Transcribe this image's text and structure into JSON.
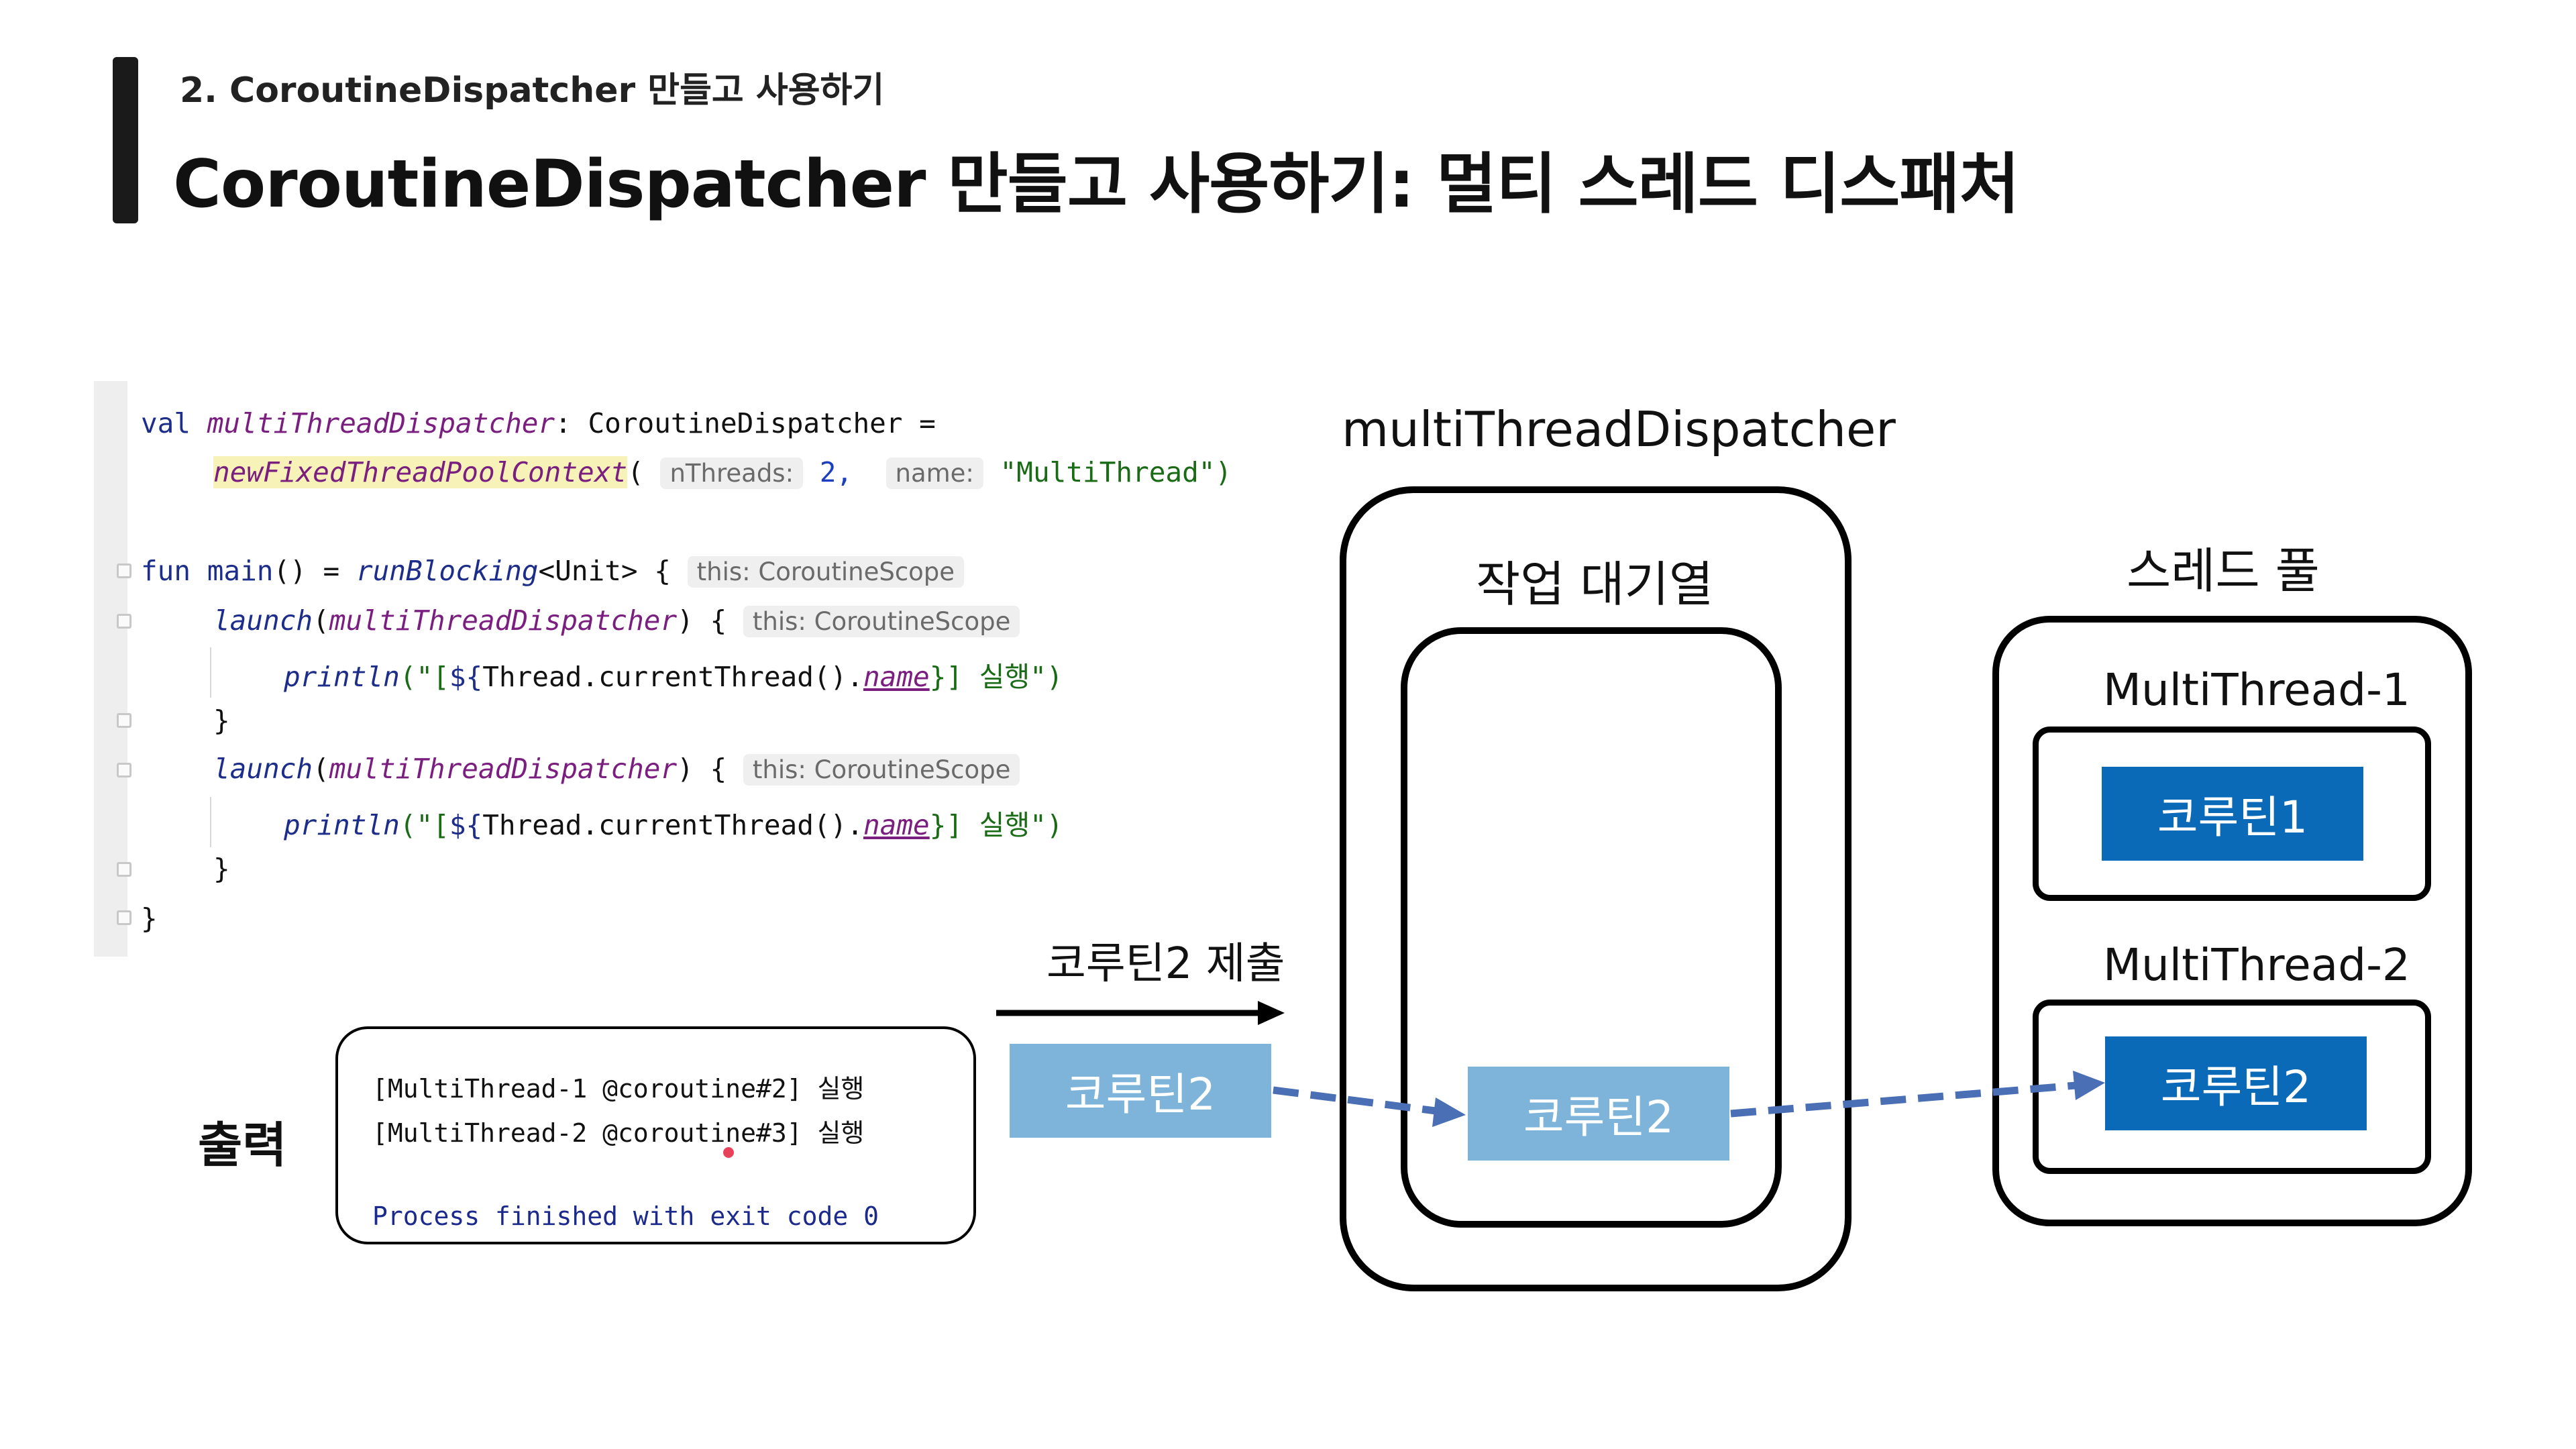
{
  "header": {
    "subtitle": "2. CoroutineDispatcher 만들고 사용하기",
    "title": "CoroutineDispatcher 만들고 사용하기: 멀티 스레드 디스패처"
  },
  "code": {
    "l1_val": "val",
    "l1_name": "multiThreadDispatcher",
    "l1_type": ": CoroutineDispatcher =",
    "l2_fn": "newFixedThreadPoolContext",
    "l2_open": "(",
    "l2_hint1": "nThreads:",
    "l2_num": "2,",
    "l2_hint2": "name:",
    "l2_str": "\"MultiThread\")",
    "l3_fun": "fun",
    "l3_main": "main",
    "l3_mid": "() =",
    "l3_run": "runBlocking",
    "l3_end": "<Unit> {",
    "hint_scope": "this: CoroutineScope",
    "launch": "launch",
    "launch_arg": "multiThreadDispatcher",
    "launch_end": ") {",
    "println": "println",
    "p_open": "(\"[",
    "p_tmpl": "${",
    "p_thread": "Thread.currentThread().",
    "p_name": "name",
    "p_close": "}] 실행\")",
    "close_inner": "}",
    "close_outer": "}"
  },
  "diagram": {
    "dispatcher_label": "multiThreadDispatcher",
    "queue_label": "작업 대기열",
    "pool_label": "스레드 풀",
    "thread1_label": "MultiThread-1",
    "thread2_label": "MultiThread-2",
    "coroutine1": "코루틴1",
    "coroutine2": "코루틴2",
    "submit_label": "코루틴2 제출"
  },
  "output": {
    "label": "출력",
    "line1": "[MultiThread-1 @coroutine#2] 실행",
    "line2": "[MultiThread-2 @coroutine#3] 실행",
    "line3": "Process finished with exit code 0"
  },
  "colors": {
    "coroutine_dark": "#0a6ab8",
    "coroutine_light": "#7eb3da",
    "arrow": "#4a6fb5"
  }
}
